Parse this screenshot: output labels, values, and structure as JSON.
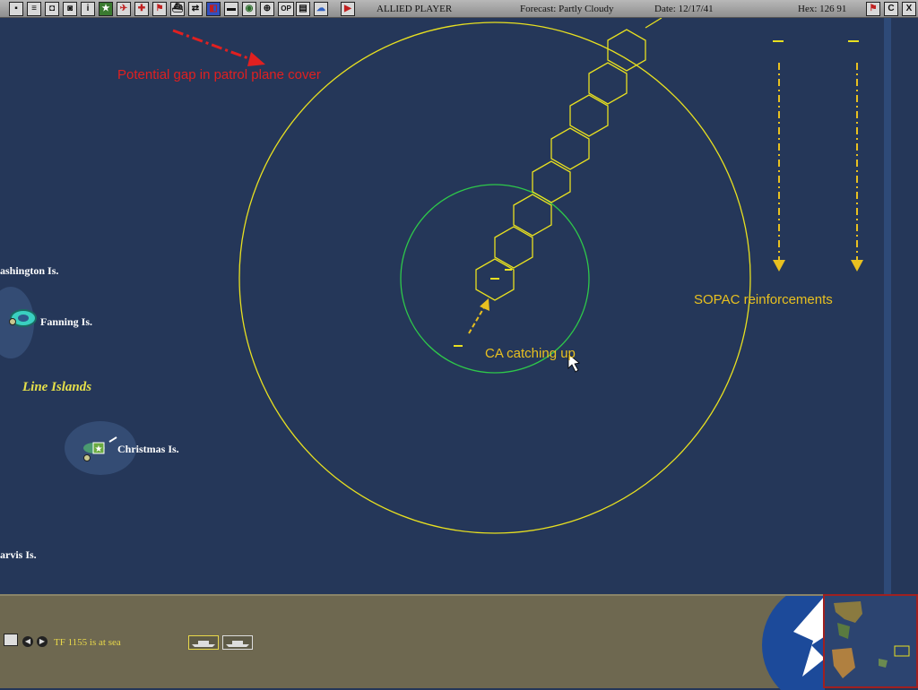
{
  "toolbar": {
    "player": "ALLIED PLAYER",
    "forecast": "Forecast: Partly Cloudy",
    "date": "Date: 12/17/41",
    "hex": "Hex: 126 91",
    "right_buttons": [
      "C",
      "X"
    ]
  },
  "map": {
    "annotations": {
      "patrol_gap": "Potential gap in patrol plane cover",
      "sopac": "SOPAC reinforcements",
      "ca_catching_up": "CA catching up"
    },
    "places": {
      "washington": "ashington Is.",
      "fanning": "Fanning Is.",
      "line_islands": "Line Islands",
      "christmas": "Christmas Is.",
      "jarvis": "arvis Is."
    }
  },
  "bottom": {
    "status": "TF 1155 is at sea"
  },
  "colors": {
    "ocean": "#253759",
    "range_outer": "#e8e020",
    "range_inner": "#2ec84a",
    "annotation_red": "#e02020",
    "annotation_yellow": "#e8c020"
  }
}
